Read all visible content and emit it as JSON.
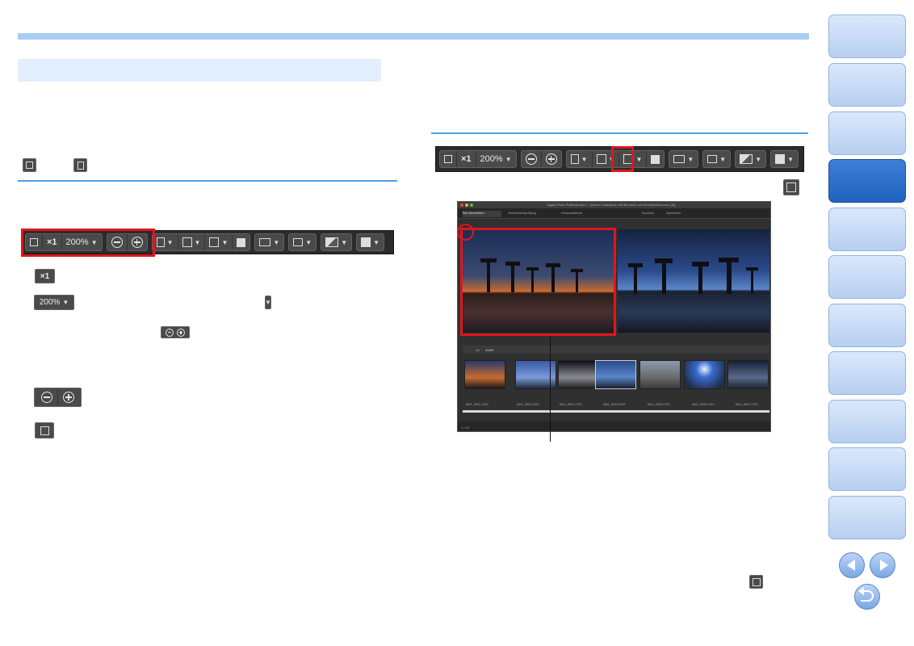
{
  "toolbar_top": {
    "zoom_1x": "×1",
    "zoom_level": "200%"
  },
  "toolbar_left": {
    "zoom_1x": "×1",
    "zoom_level": "200%"
  },
  "items": {
    "x1_label": "×1",
    "zoom_button_label": "200%"
  },
  "screenshot": {
    "title": "Digital Photo Professional 4 – [Ordner: Macintosh HD:Benutzer:xxx:Schnellsicht:xxxxx (8)]",
    "tabs": [
      "Bild bearbeiten",
      "Schnellüberprüfung",
      "Fernaufnahme"
    ],
    "print_label": "Drucken",
    "save_label": "Speichern",
    "zoom_level": "200%",
    "zoom_1x": "×1",
    "count": "1 / 12",
    "file_names": [
      "IMG_0001.CR2",
      "IMG_0003.CR2",
      "IMG_0004.CR2",
      "IMG_0015.CR2",
      "IMG_0005.CR2",
      "IMG_0006.CR2",
      "IMG_0007.CR2"
    ]
  },
  "colors": {
    "accent_blue": "#4aa0e8",
    "highlight_red": "#e0161c",
    "nav_active": "#2063bf"
  }
}
